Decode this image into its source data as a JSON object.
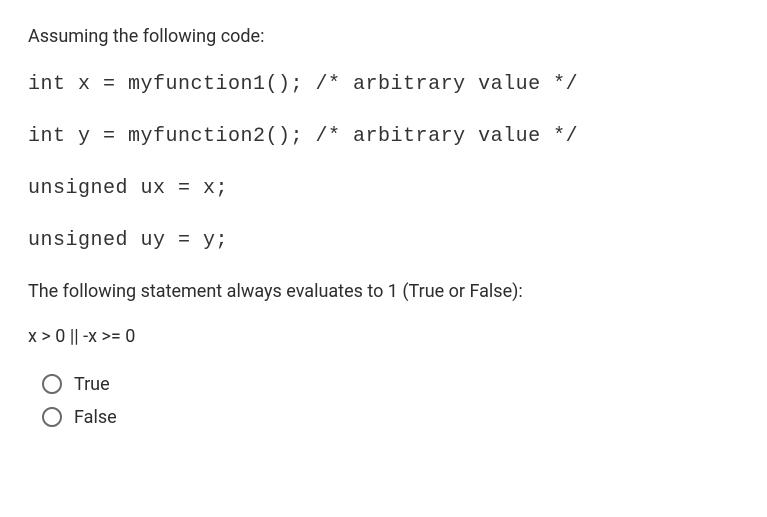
{
  "intro": "Assuming the following code:",
  "code": {
    "line1": "int x = myfunction1(); /* arbitrary value */",
    "line2": "int y = myfunction2(); /* arbitrary value */",
    "line3": "unsigned ux = x;",
    "line4": "unsigned uy = y;"
  },
  "statement": "The following statement always evaluates to 1 (True or False):",
  "expression": "x > 0 || -x >= 0",
  "options": {
    "true_label": "True",
    "false_label": "False"
  }
}
